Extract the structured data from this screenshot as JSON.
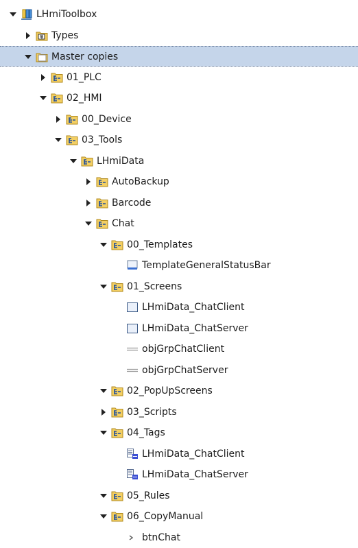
{
  "tree": {
    "rows": [
      {
        "label": "LHmiToolbox",
        "level": 0,
        "state": "expanded",
        "icon": "library-icon"
      },
      {
        "label": "Types",
        "level": 1,
        "state": "collapsed",
        "icon": "types-folder-icon"
      },
      {
        "label": "Master copies",
        "level": 1,
        "state": "expanded",
        "icon": "master-copies-folder-icon",
        "selected": true
      },
      {
        "label": "01_PLC",
        "level": 2,
        "state": "collapsed",
        "icon": "group-folder-icon"
      },
      {
        "label": "02_HMI",
        "level": 2,
        "state": "expanded",
        "icon": "group-folder-icon"
      },
      {
        "label": "00_Device",
        "level": 3,
        "state": "collapsed",
        "icon": "group-folder-icon"
      },
      {
        "label": "03_Tools",
        "level": 3,
        "state": "expanded",
        "icon": "group-folder-icon"
      },
      {
        "label": "LHmiData",
        "level": 4,
        "state": "expanded",
        "icon": "group-folder-icon"
      },
      {
        "label": "AutoBackup",
        "level": 5,
        "state": "collapsed",
        "icon": "group-folder-icon"
      },
      {
        "label": "Barcode",
        "level": 5,
        "state": "collapsed",
        "icon": "group-folder-icon"
      },
      {
        "label": "Chat",
        "level": 5,
        "state": "expanded",
        "icon": "group-folder-icon"
      },
      {
        "label": "00_Templates",
        "level": 6,
        "state": "expanded",
        "icon": "group-folder-icon"
      },
      {
        "label": "TemplateGeneralStatusBar",
        "level": 7,
        "state": "leaf",
        "icon": "template-icon"
      },
      {
        "label": "01_Screens",
        "level": 6,
        "state": "expanded",
        "icon": "group-folder-icon"
      },
      {
        "label": "LHmiData_ChatClient",
        "level": 7,
        "state": "leaf",
        "icon": "screen-icon"
      },
      {
        "label": "LHmiData_ChatServer",
        "level": 7,
        "state": "leaf",
        "icon": "screen-icon"
      },
      {
        "label": "objGrpChatClient",
        "level": 7,
        "state": "leaf",
        "icon": "object-group-icon"
      },
      {
        "label": "objGrpChatServer",
        "level": 7,
        "state": "leaf",
        "icon": "object-group-icon"
      },
      {
        "label": "02_PopUpScreens",
        "level": 6,
        "state": "expanded",
        "icon": "group-folder-icon"
      },
      {
        "label": "03_Scripts",
        "level": 6,
        "state": "collapsed",
        "icon": "group-folder-icon"
      },
      {
        "label": "04_Tags",
        "level": 6,
        "state": "expanded",
        "icon": "group-folder-icon"
      },
      {
        "label": "LHmiData_ChatClient",
        "level": 7,
        "state": "leaf",
        "icon": "tag-table-icon"
      },
      {
        "label": "LHmiData_ChatServer",
        "level": 7,
        "state": "leaf",
        "icon": "tag-table-icon"
      },
      {
        "label": "05_Rules",
        "level": 6,
        "state": "expanded",
        "icon": "group-folder-icon"
      },
      {
        "label": "06_CopyManual",
        "level": 6,
        "state": "expanded",
        "icon": "group-folder-icon"
      },
      {
        "label": "btnChat",
        "level": 7,
        "state": "leaf",
        "icon": "button-element-icon"
      }
    ]
  }
}
